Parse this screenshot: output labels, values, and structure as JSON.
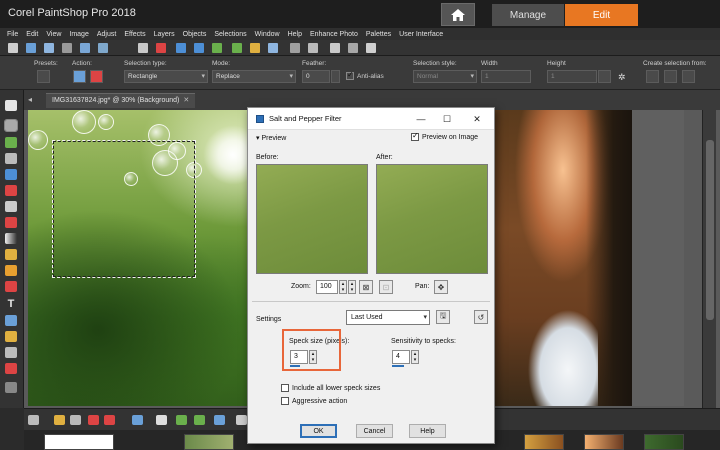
{
  "app": {
    "title": "Corel PaintShop Pro 2018",
    "workspace_tabs": [
      "Manage",
      "Edit"
    ],
    "active_tab": "Edit",
    "accent_color": "#e87722"
  },
  "menu": [
    "File",
    "Edit",
    "View",
    "Image",
    "Adjust",
    "Effects",
    "Layers",
    "Objects",
    "Selections",
    "Window",
    "Help",
    "Enhance Photo",
    "Palettes",
    "User Interface"
  ],
  "tool_options": {
    "presets_label": "Presets:",
    "action_label": "Action:",
    "selection_type_label": "Selection type:",
    "selection_type_value": "Rectangle",
    "mode_label": "Mode:",
    "mode_value": "Replace",
    "feather_label": "Feather:",
    "feather_value": "0",
    "anti_alias_label": "Anti-alias",
    "selection_style_label": "Selection style:",
    "selection_style_value": "Normal",
    "width_label": "Width",
    "width_value": "1",
    "height_label": "Height",
    "height_value": "1",
    "create_selection_label": "Create selection from:"
  },
  "document": {
    "tab_label": "IMG31637824.jpg* @  30% (Background)"
  },
  "dialog": {
    "title": "Salt and Pepper Filter",
    "preview_section": "Preview",
    "preview_on_image_label": "Preview on Image",
    "preview_on_image_checked": true,
    "before_label": "Before:",
    "after_label": "After:",
    "zoom_label": "Zoom:",
    "zoom_value": "100",
    "pan_label": "Pan:",
    "settings_label": "Settings",
    "settings_value": "Last Used",
    "speck_size_label": "Speck size (pixels):",
    "speck_size_value": "3",
    "sensitivity_label": "Sensitivity to specks:",
    "sensitivity_value": "4",
    "include_lower_label": "Include all lower speck sizes",
    "aggressive_label": "Aggressive action",
    "ok_label": "OK",
    "cancel_label": "Cancel",
    "help_label": "Help",
    "highlight_color": "#e8663a"
  }
}
